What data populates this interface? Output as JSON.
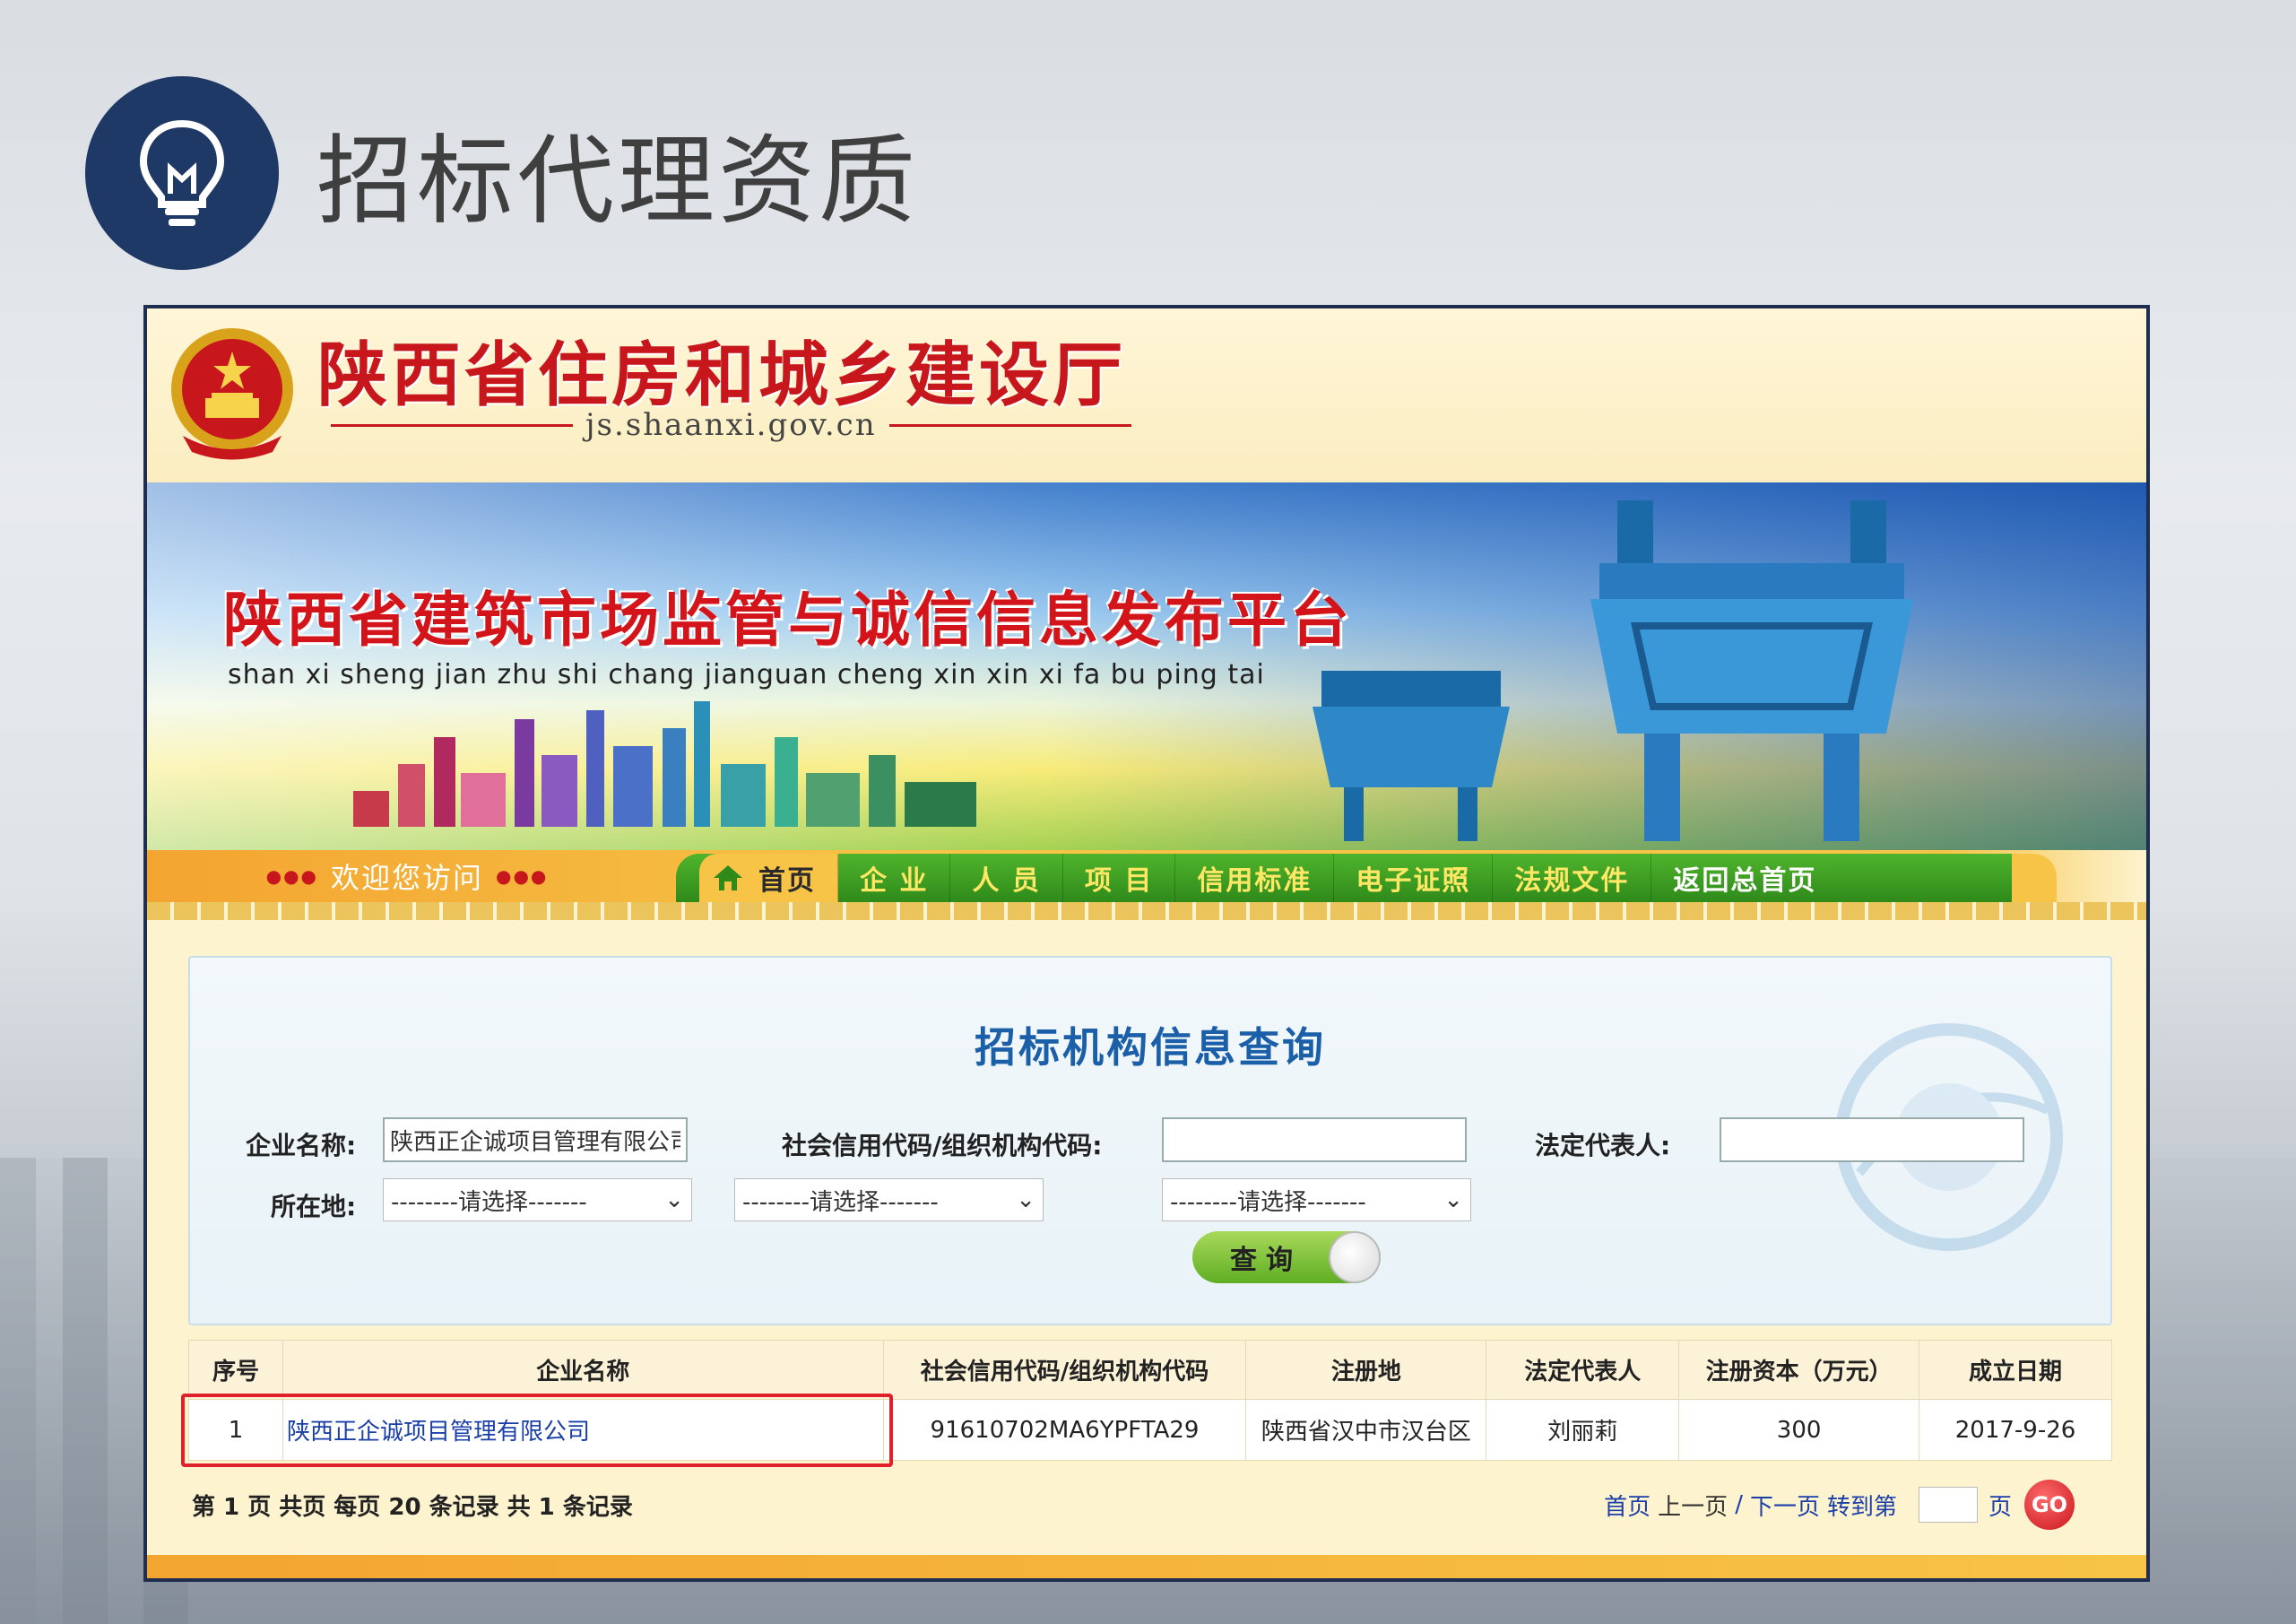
{
  "slide": {
    "title": "招标代理资质",
    "icon": "lightbulb-icon"
  },
  "site": {
    "name": "陕西省住房和城乡建设厅",
    "url": "js.shaanxi.gov.cn",
    "banner_title": "陕西省建筑市场监管与诚信信息发布平台",
    "banner_pinyin": "shan xi sheng jian zhu shi chang jianguan cheng xin xin xi fa bu ping tai",
    "welcome": "欢迎您访问"
  },
  "nav": {
    "items": [
      {
        "label": "首页"
      },
      {
        "label": "企 业"
      },
      {
        "label": "人 员"
      },
      {
        "label": "项 目"
      },
      {
        "label": "信用标准"
      },
      {
        "label": "电子证照"
      },
      {
        "label": "法规文件"
      },
      {
        "label": "返回总首页"
      }
    ]
  },
  "query": {
    "title": "招标机构信息查询",
    "company_label": "企业名称:",
    "company_value": "陕西正企诚项目管理有限公司",
    "credit_label": "社会信用代码/组织机构代码:",
    "credit_value": "",
    "legal_rep_label": "法定代表人:",
    "legal_rep_value": "",
    "location_label": "所在地:",
    "select1": "--------请选择-------",
    "select2": "--------请选择-------",
    "select3": "--------请选择-------",
    "button": "查询"
  },
  "table": {
    "headers": [
      "序号",
      "企业名称",
      "社会信用代码/组织机构代码",
      "注册地",
      "法定代表人",
      "注册资本（万元）",
      "成立日期"
    ],
    "rows": [
      [
        "1",
        "陕西正企诚项目管理有限公司",
        "91610702MA6YPFTA29",
        "陕西省汉中市汉台区",
        "刘丽莉",
        "300",
        "2017-9-26"
      ]
    ]
  },
  "pager": {
    "summary": "第 1 页 共页 每页 20 条记录 共 1 条记录",
    "first": "首页",
    "prev": "上一页",
    "sep": "/",
    "next": "下一页",
    "goto": "转到第",
    "page_unit": "页",
    "go": "GO"
  },
  "colors": {
    "badge": "#1f3966",
    "brand_red": "#c8161d",
    "nav_green": "#2f8a1a",
    "highlight": "#e0202a"
  }
}
